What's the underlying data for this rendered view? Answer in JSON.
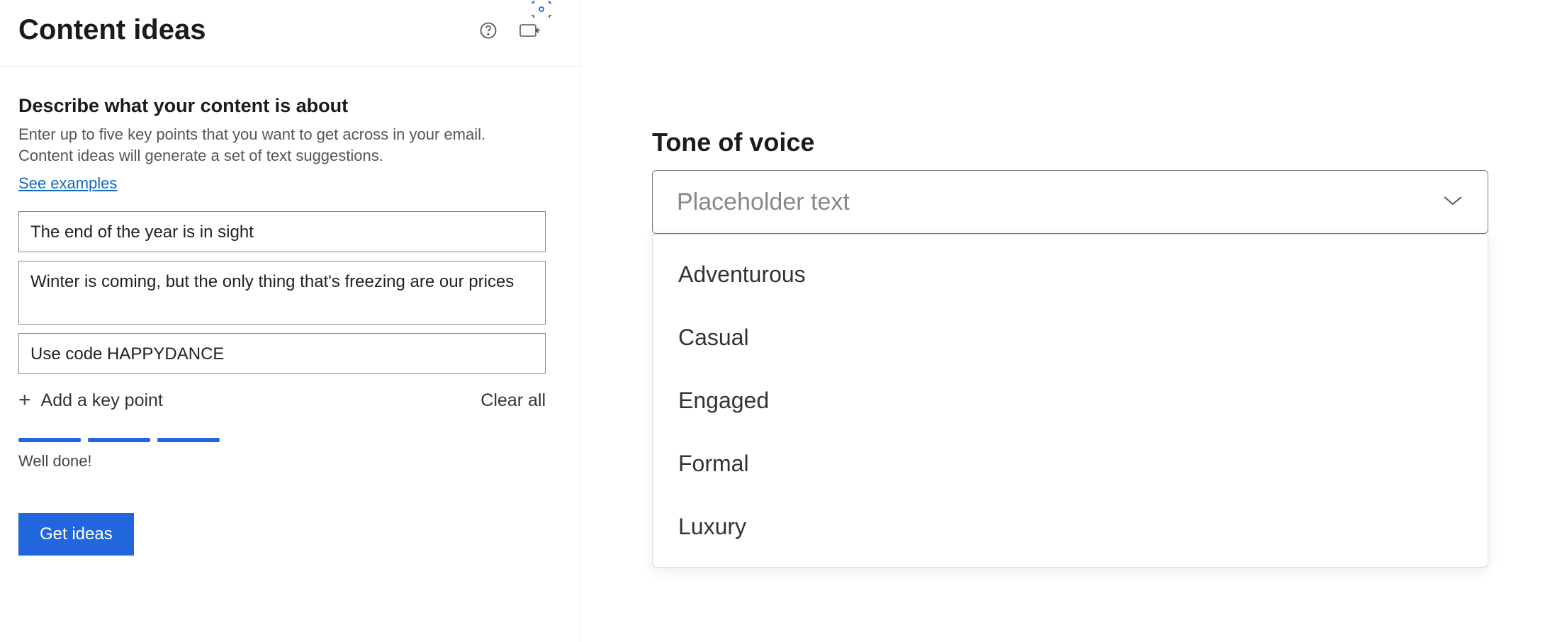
{
  "header": {
    "title": "Content ideas"
  },
  "describe": {
    "heading": "Describe what your content is about",
    "description": "Enter up to five key points that you want to get across in your email. Content ideas will generate a set of text suggestions.",
    "see_examples": "See examples"
  },
  "key_points": {
    "items": [
      "The end of the year is in sight",
      "Winter is coming, but the only thing that's freezing are our prices",
      "Use code HAPPYDANCE"
    ],
    "add_label": "Add a key point",
    "clear_label": "Clear all"
  },
  "progress": {
    "label": "Well done!"
  },
  "actions": {
    "get_ideas": "Get ideas"
  },
  "tone": {
    "heading": "Tone of voice",
    "placeholder": "Placeholder text",
    "options": [
      "Adventurous",
      "Casual",
      "Engaged",
      "Formal",
      "Luxury"
    ]
  }
}
